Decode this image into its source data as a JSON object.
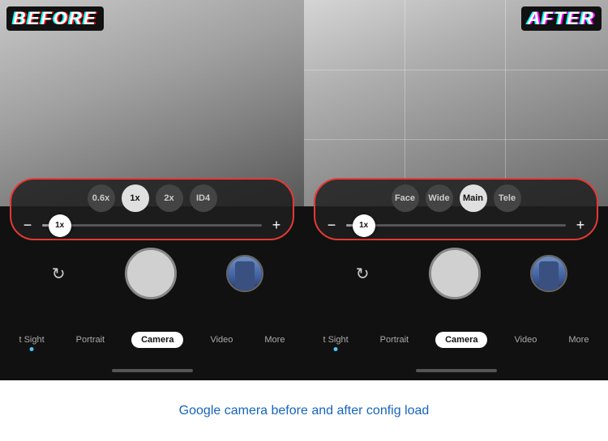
{
  "before": {
    "label": "BEFORE",
    "zoomButtons": [
      {
        "id": "btn-0.6x",
        "label": "0.6x",
        "active": false
      },
      {
        "id": "btn-1x",
        "label": "1x",
        "active": true
      },
      {
        "id": "btn-2x",
        "label": "2x",
        "active": false
      },
      {
        "id": "btn-id4",
        "label": "ID4",
        "active": false
      }
    ],
    "sliderValue": "1x",
    "minus": "−",
    "plus": "+",
    "modeTabs": [
      {
        "id": "sight",
        "label": "t Sight",
        "active": false,
        "dot": true
      },
      {
        "id": "portrait",
        "label": "Portrait",
        "active": false,
        "dot": false
      },
      {
        "id": "camera",
        "label": "Camera",
        "active": true,
        "dot": false
      },
      {
        "id": "video",
        "label": "Video",
        "active": false,
        "dot": false
      },
      {
        "id": "more",
        "label": "More",
        "active": false,
        "dot": false
      }
    ]
  },
  "after": {
    "label": "AFTER",
    "zoomButtons": [
      {
        "id": "btn-face",
        "label": "Face",
        "active": false
      },
      {
        "id": "btn-wide",
        "label": "Wide",
        "active": false
      },
      {
        "id": "btn-main",
        "label": "Main",
        "active": true
      },
      {
        "id": "btn-tele",
        "label": "Tele",
        "active": false
      }
    ],
    "sliderValue": "1x",
    "minus": "−",
    "plus": "+",
    "modeTabs": [
      {
        "id": "sight",
        "label": "t Sight",
        "active": false,
        "dot": true
      },
      {
        "id": "portrait",
        "label": "Portrait",
        "active": false,
        "dot": false
      },
      {
        "id": "camera",
        "label": "Camera",
        "active": true,
        "dot": false
      },
      {
        "id": "video",
        "label": "Video",
        "active": false,
        "dot": false
      },
      {
        "id": "more",
        "label": "More",
        "active": false,
        "dot": false
      }
    ]
  },
  "caption": {
    "text": "Google camera before and after config load"
  }
}
